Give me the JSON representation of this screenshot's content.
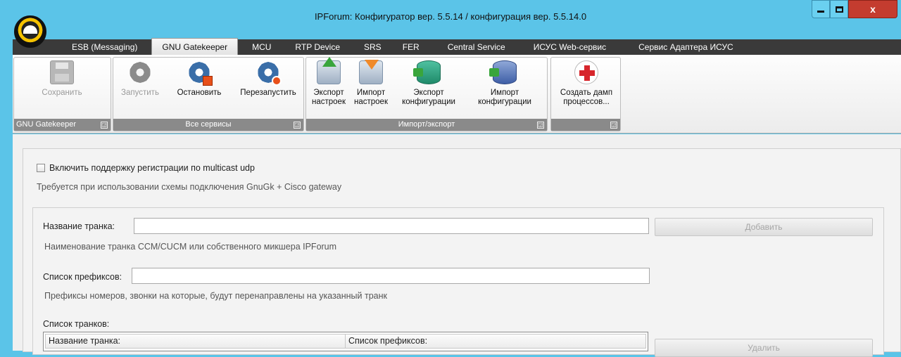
{
  "window": {
    "title": "IPForum: Конфигуратор вер. 5.5.14 / конфигурация вер. 5.5.14.0",
    "minimize_glyph": "minimize-icon",
    "maximize_glyph": "maximize-icon",
    "close_label": "x"
  },
  "tabs": [
    {
      "label": "ESB (Messaging)"
    },
    {
      "label": "GNU Gatekeeper",
      "active": true
    },
    {
      "label": "MCU"
    },
    {
      "label": "RTP Device"
    },
    {
      "label": "SRS"
    },
    {
      "label": "FER"
    },
    {
      "label": "Central Service"
    },
    {
      "label": "ИСУС Web-сервис"
    },
    {
      "label": "Сервис Адаптера ИСУС"
    }
  ],
  "ribbon": {
    "groups": {
      "gatekeeper": {
        "label": "GNU Gatekeeper"
      },
      "services": {
        "label": "Все сервисы"
      },
      "importexport": {
        "label": "Импорт/экспорт"
      },
      "dump": {
        "label": ""
      }
    },
    "buttons": {
      "save": {
        "label": "Сохранить",
        "icon": "floppy-disk-icon"
      },
      "start": {
        "label": "Запустить",
        "icon": "gear-start-icon"
      },
      "stop": {
        "label": "Остановить",
        "icon": "gear-stop-icon"
      },
      "restart": {
        "label": "Перезапустить",
        "icon": "gear-restart-icon"
      },
      "export_settings": {
        "line1": "Экспорт",
        "line2": "настроек",
        "icon": "export-arrow-icon"
      },
      "import_settings": {
        "line1": "Импорт",
        "line2": "настроек",
        "icon": "import-arrow-icon"
      },
      "export_config": {
        "line1": "Экспорт",
        "line2": "конфигурации",
        "icon": "export-database-icon"
      },
      "import_config": {
        "line1": "Импорт",
        "line2": "конфигурации",
        "icon": "import-database-icon"
      },
      "dump": {
        "line1": "Создать дамп",
        "line2": "процессов...",
        "icon": "medkit-icon"
      }
    }
  },
  "main": {
    "multicast_checkbox_label": "Включить поддержку регистрации по multicast udp",
    "multicast_checked": false,
    "multicast_hint": "Требуется при использовании схемы подключения GnuGk + Cisco gateway",
    "trunk_name_label": "Название транка:",
    "trunk_name_value": "",
    "trunk_name_hint": "Наименование транка CCM/CUCM или собственного микшера IPForum",
    "add_button": "Добавить",
    "prefix_list_label": "Список префиксов:",
    "prefix_list_value": "",
    "prefix_list_hint": "Префиксы номеров, звонки на которые, будут перенаправлены на указанный транк",
    "trunk_list_label": "Список транков:",
    "grid_columns": [
      "Название транка:",
      "Список префиксов:"
    ],
    "delete_button": "Удалить"
  }
}
